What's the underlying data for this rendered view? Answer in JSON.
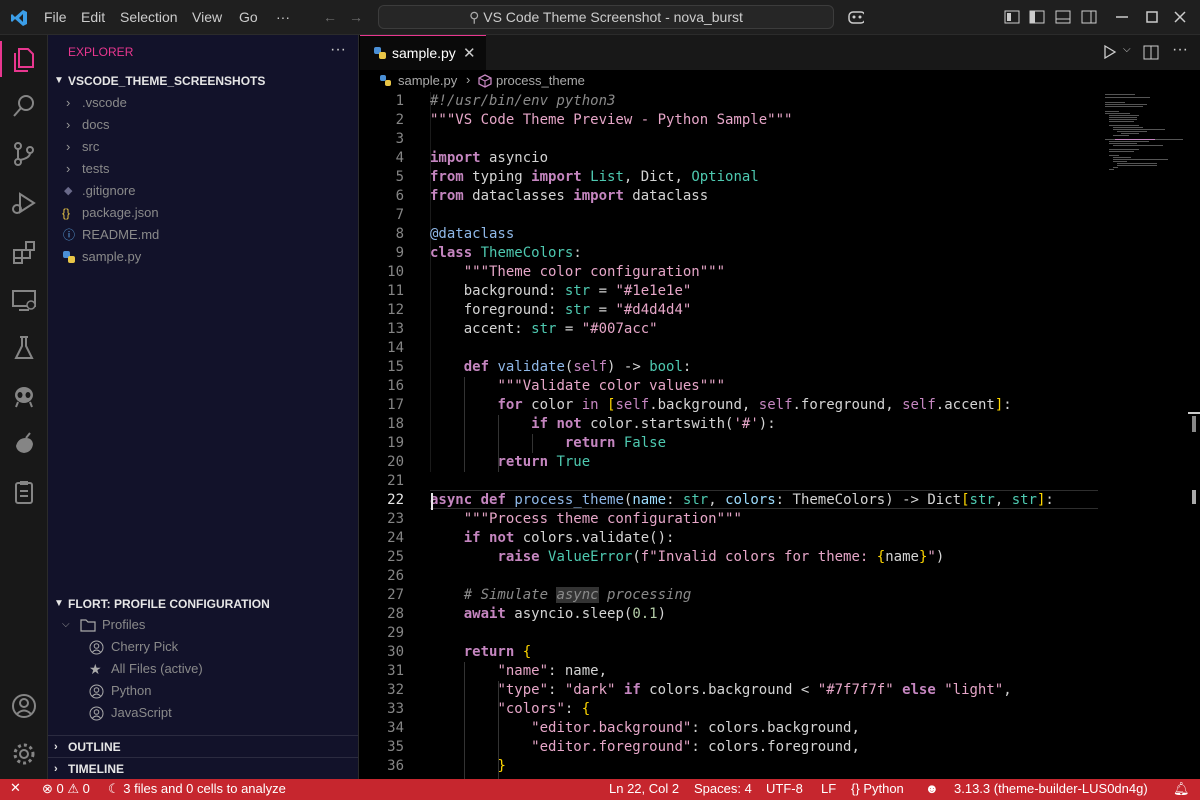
{
  "titlebar": {
    "menu": [
      "File",
      "Edit",
      "Selection",
      "View",
      "Go"
    ],
    "more": "···",
    "search_text": "VS Code Theme Screenshot - nova_burst"
  },
  "sidebar": {
    "explorer_title": "EXPLORER",
    "workspace": "VSCODE_THEME_SCREENSHOTS",
    "items": [
      {
        "label": ".vscode",
        "kind": "folder"
      },
      {
        "label": "docs",
        "kind": "folder"
      },
      {
        "label": "src",
        "kind": "folder"
      },
      {
        "label": "tests",
        "kind": "folder"
      },
      {
        "label": ".gitignore",
        "kind": "file",
        "icon": "◆"
      },
      {
        "label": "package.json",
        "kind": "file",
        "icon": "{}"
      },
      {
        "label": "README.md",
        "kind": "file",
        "icon": "ⓘ"
      },
      {
        "label": "sample.py",
        "kind": "file",
        "icon": "py"
      }
    ],
    "profile_section": "FLORT: PROFILE CONFIGURATION",
    "profiles_label": "Profiles",
    "profiles": [
      "Cherry Pick",
      "All Files (active)",
      "Python",
      "JavaScript"
    ],
    "outline": "OUTLINE",
    "timeline": "TIMELINE"
  },
  "editor": {
    "tab": "sample.py",
    "breadcrumb_file": "sample.py",
    "breadcrumb_symbol": "process_theme",
    "current_line": 22
  },
  "statusbar": {
    "errors": "0",
    "warnings": "0",
    "analysis": "3 files and 0 cells to analyze",
    "position": "Ln 22, Col 2",
    "spaces": "Spaces: 4",
    "encoding": "UTF-8",
    "eol": "LF",
    "language": "Python",
    "interpreter": "3.13.3 (theme-builder-LUS0dn4g)"
  },
  "colors": {
    "accent": "#c6262e",
    "tab_border": "#e8378f",
    "sidebar_bg": "#12122a"
  }
}
